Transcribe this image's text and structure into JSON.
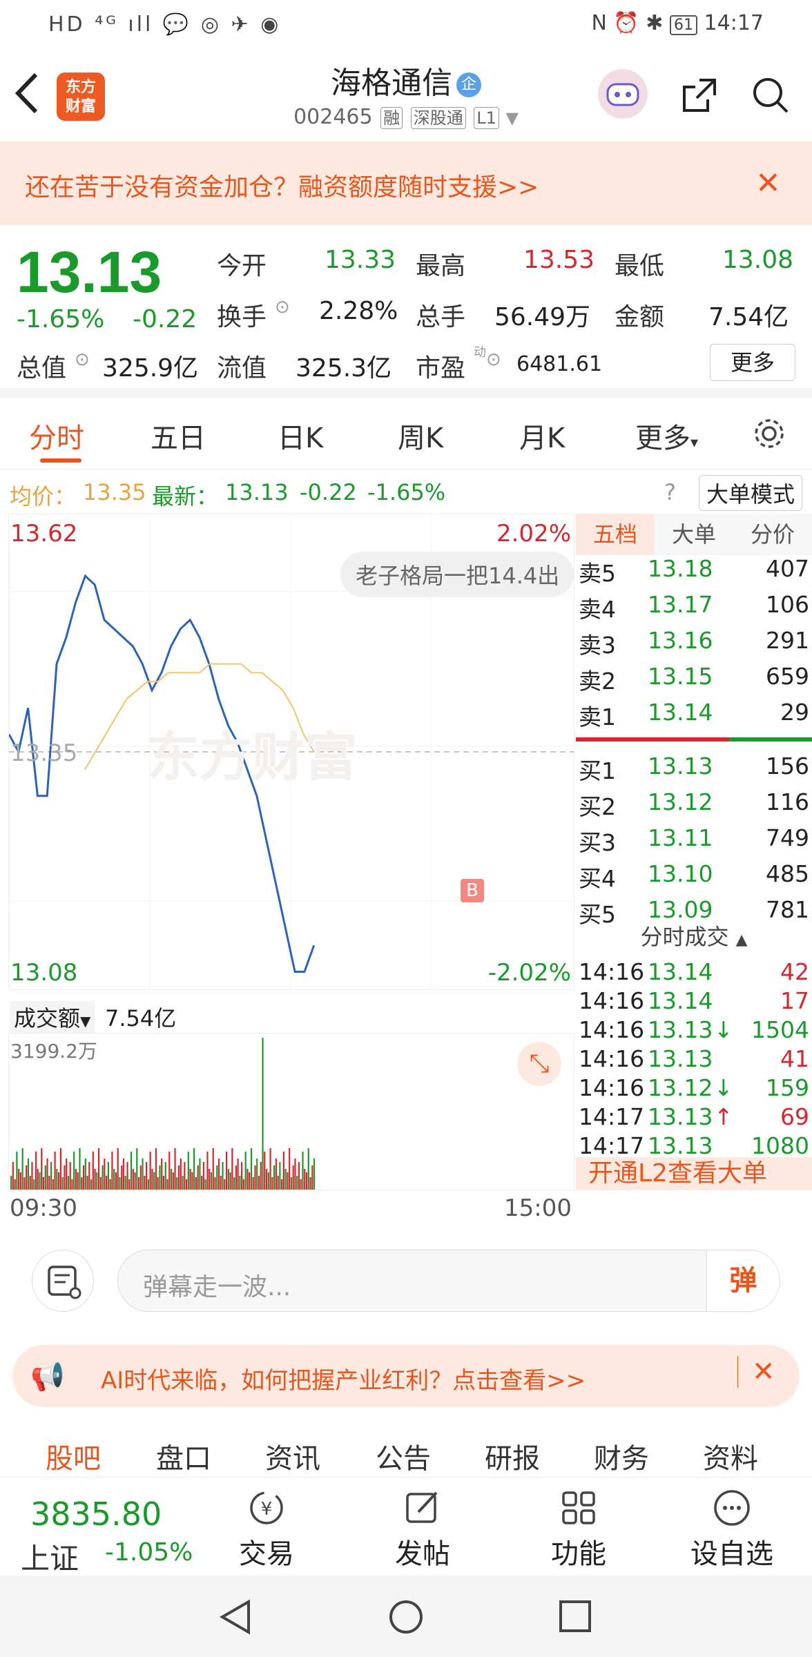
{
  "status_bar": {
    "left": "HD ⁴ᴳ ıll 💬 ◎ ✈ ◉",
    "battery": "61",
    "time": "14:17"
  },
  "header": {
    "logo": "东方\n财富",
    "name": "海格通信",
    "badge": "企",
    "code": "002465",
    "tags": [
      "融",
      "深股通",
      "L1"
    ]
  },
  "banner": {
    "text": "还在苦于没有资金加仓？融资额度随时支援>>",
    "close": "✕"
  },
  "quote": {
    "price": "13.13",
    "change_pct": "-1.65%",
    "change": "-0.22",
    "open_label": "今开",
    "open": "13.33",
    "high_label": "最高",
    "high": "13.53",
    "low_label": "最低",
    "low": "13.08",
    "turnover_label": "换手",
    "turnover": "2.28%",
    "volume_label": "总手",
    "volume": "56.49万",
    "amount_label": "金额",
    "amount": "7.54亿",
    "mktcap_label": "总值",
    "mktcap": "325.9亿",
    "float_label": "流值",
    "float": "325.3亿",
    "pe_label": "市盈",
    "pe_sup": "动",
    "pe": "6481.61",
    "more": "更多"
  },
  "tabs": [
    "分时",
    "五日",
    "日K",
    "周K",
    "月K",
    "更多"
  ],
  "avg_line": {
    "avg_label": "均价：",
    "avg": "13.35",
    "latest_label": "最新：",
    "latest": "13.13",
    "chg": "-0.22",
    "pct": "-1.65%",
    "mode_btn": "大单模式"
  },
  "chart": {
    "max": "13.62",
    "max_pct": "2.02%",
    "min": "13.08",
    "min_pct": "-2.02%",
    "avg_axis": "13.35",
    "comment": "老子格局一把14.4出",
    "watermark": "东方财富",
    "marker": "B",
    "volume_label": "成交额",
    "volume_value": "7.54亿",
    "vol_max": "3199.2万",
    "start": "09:30",
    "end": "15:00"
  },
  "chart_data": {
    "type": "line",
    "title": "",
    "x": [
      "09:30",
      "15:00"
    ],
    "ylim": [
      13.08,
      13.62
    ],
    "avg": 13.35,
    "series": [
      {
        "name": "",
        "values": [
          13.37,
          13.35,
          13.4,
          13.3,
          13.3,
          13.45,
          13.48,
          13.52,
          13.55,
          13.54,
          13.5,
          13.49,
          13.48,
          13.47,
          13.45,
          13.42,
          13.44,
          13.47,
          13.49,
          13.5,
          13.48,
          13.45,
          13.41,
          13.38,
          13.36,
          13.33,
          13.3,
          13.25,
          13.2,
          13.15,
          13.1,
          13.1,
          13.13
        ]
      },
      {
        "name": "",
        "values": [
          13.33,
          13.35,
          13.37,
          13.39,
          13.41,
          13.42,
          13.43,
          13.43,
          13.44,
          13.44,
          13.44,
          13.44,
          13.45,
          13.45,
          13.45,
          13.45,
          13.44,
          13.44,
          13.43,
          13.42,
          13.4,
          13.37,
          13.35
        ]
      }
    ]
  },
  "book_tabs": [
    "五档",
    "大单",
    "分价"
  ],
  "asks": [
    [
      "卖5",
      "13.18",
      "407"
    ],
    [
      "卖4",
      "13.17",
      "106"
    ],
    [
      "卖3",
      "13.16",
      "291"
    ],
    [
      "卖2",
      "13.15",
      "659"
    ],
    [
      "卖1",
      "13.14",
      "29"
    ]
  ],
  "bids": [
    [
      "买1",
      "13.13",
      "156"
    ],
    [
      "买2",
      "13.12",
      "116"
    ],
    [
      "买3",
      "13.11",
      "749"
    ],
    [
      "买4",
      "13.10",
      "485"
    ],
    [
      "买5",
      "13.09",
      "781"
    ]
  ],
  "ticks_title": "分时成交",
  "ticks": [
    [
      "14:16",
      "13.14",
      "",
      "42",
      "red"
    ],
    [
      "14:16",
      "13.14",
      "",
      "17",
      "red"
    ],
    [
      "14:16",
      "13.13",
      "↓",
      "1504",
      "green"
    ],
    [
      "14:16",
      "13.13",
      "",
      "41",
      "red"
    ],
    [
      "14:16",
      "13.12",
      "↓",
      "159",
      "green"
    ],
    [
      "14:17",
      "13.13",
      "↑",
      "69",
      "red"
    ],
    [
      "14:17",
      "13.13",
      "",
      "1080",
      "green"
    ]
  ],
  "l2": "开通L2查看大单",
  "input": {
    "placeholder": "弹幕走一波...",
    "btn": "弹"
  },
  "ad": {
    "text": "AI时代来临，如何把握产业红利？点击查看>>"
  },
  "bottom_tabs": [
    "股吧",
    "盘口",
    "资讯",
    "公告",
    "研报",
    "财务",
    "资料"
  ],
  "index": {
    "value": "3835.80",
    "name": "上证",
    "pct": "-1.05%"
  },
  "actions": [
    {
      "label": "交易",
      "icon": "yuan-icon"
    },
    {
      "label": "发帖",
      "icon": "edit-icon"
    },
    {
      "label": "功能",
      "icon": "grid-icon"
    },
    {
      "label": "设自选",
      "icon": "more-icon"
    }
  ]
}
